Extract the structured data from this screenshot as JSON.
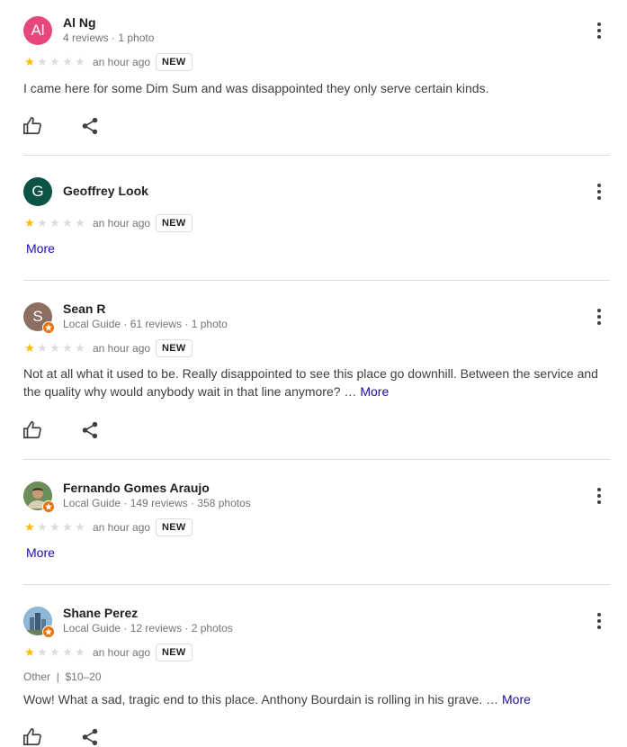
{
  "reviews": [
    {
      "avatar_letter": "Al",
      "avatar_color": "#e8477b",
      "name": "Al Ng",
      "meta": "4 reviews · 1 photo",
      "rating": 1,
      "time": "an hour ago",
      "badge": "NEW",
      "text": "I came here for some Dim Sum and was disappointed they only serve certain kinds."
    },
    {
      "avatar_letter": "G",
      "avatar_color": "#0b5345",
      "name": "Geoffrey Look",
      "rating": 1,
      "time": "an hour ago",
      "badge": "NEW",
      "more": "More"
    },
    {
      "avatar_letter": "S",
      "avatar_color": "#8d6e63",
      "name": "Sean R",
      "meta": "Local Guide · 61 reviews · 1 photo",
      "rating": 1,
      "time": "an hour ago",
      "badge": "NEW",
      "text": "Not at all what it used to be. Really disappointed to see this place go downhill. Between the service and the quality why would anybody wait in that line anymore? …",
      "more": "More"
    },
    {
      "name": "Fernando Gomes Araujo",
      "meta": "Local Guide · 149 reviews · 358 photos",
      "rating": 1,
      "time": "an hour ago",
      "badge": "NEW",
      "more": "More"
    },
    {
      "name": "Shane Perez",
      "meta": "Local Guide · 12 reviews · 2 photos",
      "rating": 1,
      "time": "an hour ago",
      "badge": "NEW",
      "category": "Other",
      "separator": "|",
      "price": "$10–20",
      "text": "Wow! What a sad, tragic end to this place. Anthony Bourdain is rolling in his grave. …",
      "more": "More"
    }
  ],
  "icons": {
    "like": "thumb-up-icon",
    "share": "share-icon",
    "menu": "more-vert-icon"
  },
  "colors": {
    "star": "#fbbc04",
    "link": "#1a0dab"
  }
}
